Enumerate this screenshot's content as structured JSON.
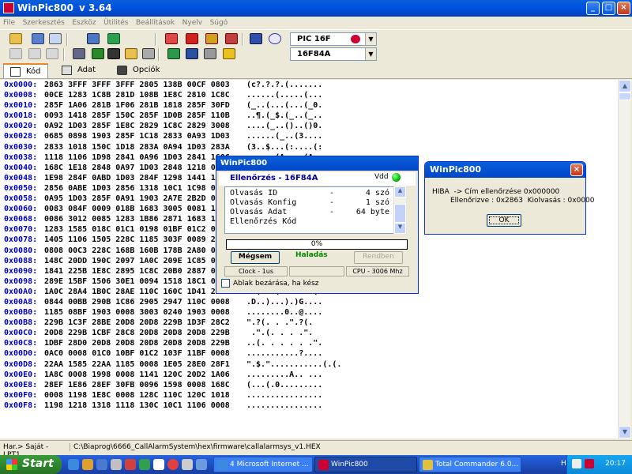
{
  "window": {
    "title": "WinPic800",
    "version": "v 3.64"
  },
  "menu": [
    "File",
    "Szerkesztés",
    "Eszköz",
    "Ütilités",
    "Beállítások",
    "Nyelv",
    "Súgó"
  ],
  "device": {
    "family": "PIC 16F",
    "chip": "16F84A"
  },
  "tabs": [
    {
      "label": "Kód",
      "active": true
    },
    {
      "label": "Adat",
      "active": false
    },
    {
      "label": "Opciók",
      "active": false
    }
  ],
  "hex_rows": [
    {
      "addr": "0x0000:",
      "words": "2863 3FFF 3FFF 3FFF 2805 138B 00CF 0803",
      "ascii": "(c?.?.?.(......."
    },
    {
      "addr": "0x0008:",
      "words": "00CE 1283 1C8B 281D 108B 1E8C 2810 1C8C",
      "ascii": "......(.....(..."
    },
    {
      "addr": "0x0010:",
      "words": "285F 1A06 281B 1F06 281B 1818 285F 30FD",
      "ascii": "(_..(...(...(_0."
    },
    {
      "addr": "0x0018:",
      "words": "0093 1418 285F 150C 285F 1D0B 285F 110B",
      "ascii": "..¶.(_$.(_..(_.."
    },
    {
      "addr": "0x0020:",
      "words": "0A92 1D03 285F 1E8C 2829 1C8C 2829 3008",
      "ascii": "....(_..()..()0."
    },
    {
      "addr": "0x0028:",
      "words": "0685 0898 1903 285F 1C18 2833 0A93 1D03",
      "ascii": "......(_..(3...."
    },
    {
      "addr": "0x0030:",
      "words": "2833 1018 150C 1D18 283A 0A94 1D03 283A",
      "ascii": "(3..$...(:....(:"
    },
    {
      "addr": "0x0038:",
      "words": "1118 1106 1D98 2841 0A96 1D03 2841 160C",
      "ascii": "......(A....(A.."
    },
    {
      "addr": "0x0040:",
      "words": "168C 1E18 2848 0A97 1D03 2848 1218 0A95",
      "ascii": "....(H....(H...."
    },
    {
      "addr": "0x0048:",
      "words": "1E98 284F 0ABD 1D03 284F 1298 1441 1285",
      "ascii": "..(O....(O...A.."
    },
    {
      "addr": "0x0050:",
      "words": "2856 0ABE 1D03 2856 1318 10C1 1C98 0008",
      "ascii": "(V....(V........"
    },
    {
      "addr": "0x0058:",
      "words": "0A95 1D03 285F 0A91 1903 2A7E 2B2D 0008",
      "ascii": "....(_....*~+-.."
    },
    {
      "addr": "0x0060:",
      "words": "0083 084F 0009 018B 1683 3005 0081 1283",
      "ascii": "...O......0....."
    },
    {
      "addr": "0x0068:",
      "words": "0086 3012 0085 1283 1B86 2871 1683 1086",
      "ascii": "..0.......(q...."
    },
    {
      "addr": "0x0070:",
      "words": "1283 1585 018C 01C1 0198 01BF 01C2 01C3",
      "ascii": "................"
    },
    {
      "addr": "0x0078:",
      "words": "1405 1106 1505 228C 1185 303F 0089 2215",
      "ascii": "......\"...0?..\"."
    },
    {
      "addr": "0x0080:",
      "words": "0808 00C3 228C 168B 160B 178B 2A80 0000",
      "ascii": "....\"......*...."
    },
    {
      "addr": "0x0088:",
      "words": "148C 20DD 190C 2097 1A0C 209E 1C85 0008",
      "ascii": ".. ... ... ....."
    },
    {
      "addr": "0x0090:",
      "words": "1841 225B 1E8C 2895 1C8C 20B0 2887 0000",
      "ascii": ".A\"[..(... .(..."
    },
    {
      "addr": "0x0098:",
      "words": "289E 15BF 1506 30E1 0094 1518 18C1 0008",
      "ascii": "(.$.$.0...$....."
    },
    {
      "addr": "0x00A0:",
      "words": "1A0C 28A4 1B0C 28AE 110C 160C 1D41 28AB",
      "ascii": "..(...(......A(."
    },
    {
      "addr": "0x00A8:",
      "words": "0844 00BB 290B 1C86 2905 2947 110C 0008",
      "ascii": ".D..)...).)G...."
    },
    {
      "addr": "0x00B0:",
      "words": "1185 08BF 1903 0008 3003 0240 1903 0008",
      "ascii": "........0..@...."
    },
    {
      "addr": "0x00B8:",
      "words": "229B 1C3F 28BE 20D8 20D8 229B 1D3F 28C2",
      "ascii": "\".?(. . .\".?(."
    },
    {
      "addr": "0x00C0:",
      "words": "20D8 229B 1CBF 28C8 20D8 20D8 20D8 229B",
      "ascii": " .\".(. . . .\"."
    },
    {
      "addr": "0x00C8:",
      "words": "1DBF 28D0 20D8 20D8 20D8 20D8 20D8 229B",
      "ascii": "..(. . . . . .\"."
    },
    {
      "addr": "0x00D0:",
      "words": "0AC0 0008 01C0 10BF 01C2 103F 11BF 0008",
      "ascii": "...........?...."
    },
    {
      "addr": "0x00D8:",
      "words": "22AA 1585 22AA 1185 0008 1E05 28E0 28F1",
      "ascii": "\".$.\"...........(.(."
    },
    {
      "addr": "0x00E0:",
      "words": "1A8C 0008 1998 0008 1141 120C 20D2 1A06",
      "ascii": ".........A.. ..."
    },
    {
      "addr": "0x00E8:",
      "words": "28EF 1E86 28EF 30FB 0096 1598 0008 168C",
      "ascii": "(...(.0........."
    },
    {
      "addr": "0x00F0:",
      "words": "0008 1198 1E8C 0008 128C 110C 120C 1018",
      "ascii": "................"
    },
    {
      "addr": "0x00F8:",
      "words": "1198 1218 1318 1118 130C 10C1 1106 0008",
      "ascii": "................"
    }
  ],
  "status": {
    "port": "Har.> Saját - LPT1",
    "file": "C:\\Biaprog\\6666_CallAlarmSystem\\hex\\firmware\\callalarmsys_v1.HEX"
  },
  "progress_dialog": {
    "title": "WinPic800",
    "header": "Ellenőrzés - 16F84A",
    "vdd_label": "Vdd",
    "log": [
      {
        "op": "Olvasás ID",
        "dash": "-",
        "result": "4 szó"
      },
      {
        "op": "Olvasás Konfig",
        "dash": "-",
        "result": "1 szó"
      },
      {
        "op": "Olvasás Adat",
        "dash": "-",
        "result": "64 byte"
      },
      {
        "op": "Ellenőrzés Kód",
        "dash": "",
        "result": ""
      }
    ],
    "progress_text": "0%",
    "progress_value": 0,
    "cancel_label": "Mégsem",
    "status_label": "Haladás",
    "ok_label": "Rendben",
    "clock": "Clock - 1us",
    "cpu": "CPU - 3006 Mhz",
    "close_checkbox": "Ablak bezárása, ha kész"
  },
  "error_dialog": {
    "title": "WinPic800",
    "line1": "HIBA  -> Cím ellenőrzése 0x000000",
    "line2": "Ellenőrizve : 0x2863  Kiolvasás : 0x0000",
    "ok_label": "OK"
  },
  "taskbar": {
    "start_label": "Start",
    "tasks": [
      {
        "label": "4 Microsoft Internet ...",
        "active": false
      },
      {
        "label": "WinPic800",
        "active": true
      },
      {
        "label": "Total Commander 6.0...",
        "active": false
      }
    ],
    "language": "HU",
    "clock": "20:17"
  },
  "colors": {
    "title_bar": "#0054e3",
    "address_text": "#0000c0",
    "progress_status": "#008800",
    "start_button": "#2e8b2e",
    "tray": "#0c8ad9"
  }
}
